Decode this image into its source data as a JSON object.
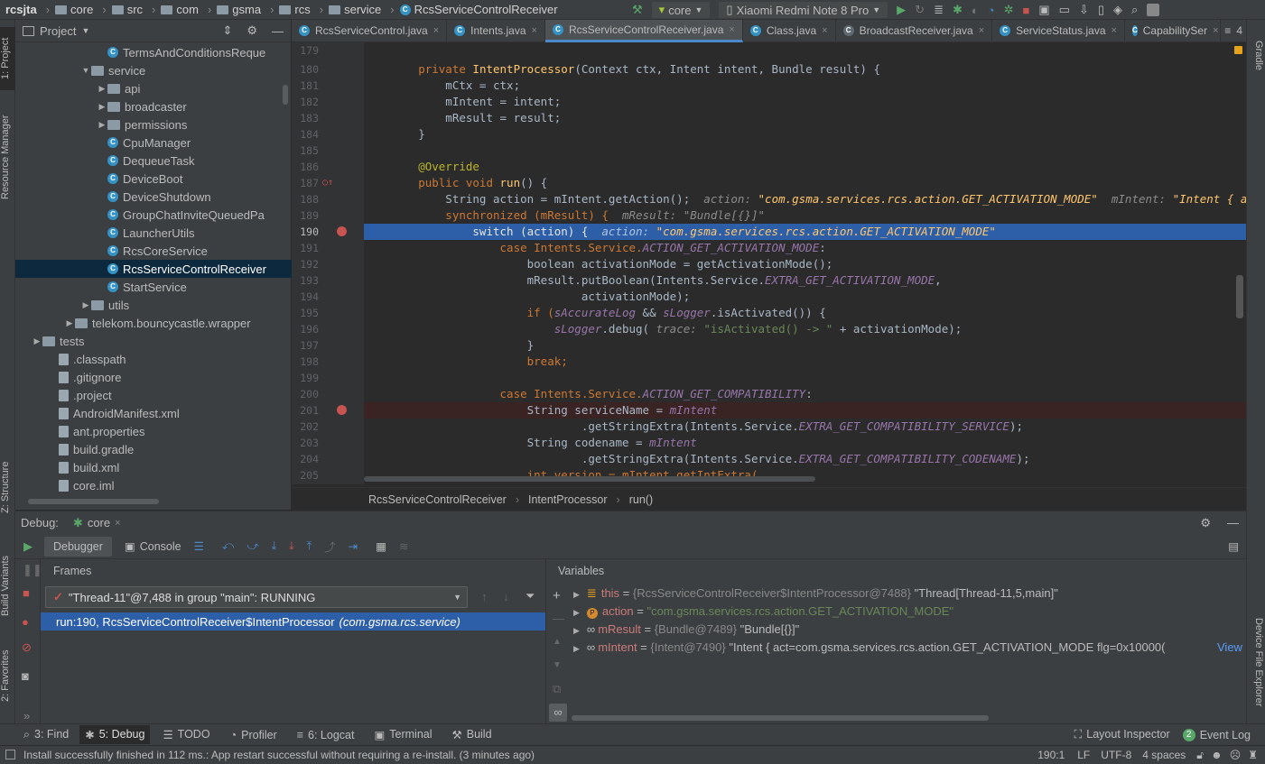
{
  "topbar": {
    "breadcrumbs": [
      "rcsjta",
      "core",
      "src",
      "com",
      "gsma",
      "rcs",
      "service",
      "RcsServiceControlReceiver"
    ],
    "run_config": "core",
    "device": "Xiaomi Redmi Note 8 Pro"
  },
  "project": {
    "title": "Project",
    "items": [
      {
        "label": "TermsAndConditionsReque",
        "type": "class"
      },
      {
        "label": "service",
        "type": "folder"
      },
      {
        "label": "api",
        "type": "folder"
      },
      {
        "label": "broadcaster",
        "type": "folder"
      },
      {
        "label": "permissions",
        "type": "folder"
      },
      {
        "label": "CpuManager",
        "type": "class"
      },
      {
        "label": "DequeueTask",
        "type": "class"
      },
      {
        "label": "DeviceBoot",
        "type": "class"
      },
      {
        "label": "DeviceShutdown",
        "type": "class"
      },
      {
        "label": "GroupChatInviteQueuedPa",
        "type": "class"
      },
      {
        "label": "LauncherUtils",
        "type": "class"
      },
      {
        "label": "RcsCoreService",
        "type": "class"
      },
      {
        "label": "RcsServiceControlReceiver",
        "type": "class"
      },
      {
        "label": "StartService",
        "type": "class"
      },
      {
        "label": "utils",
        "type": "folder"
      },
      {
        "label": "telekom.bouncycastle.wrapper",
        "type": "folder"
      },
      {
        "label": "tests",
        "type": "folder"
      },
      {
        "label": ".classpath",
        "type": "file"
      },
      {
        "label": ".gitignore",
        "type": "file"
      },
      {
        "label": ".project",
        "type": "file"
      },
      {
        "label": "AndroidManifest.xml",
        "type": "file"
      },
      {
        "label": "ant.properties",
        "type": "file"
      },
      {
        "label": "build.gradle",
        "type": "file"
      },
      {
        "label": "build.xml",
        "type": "file"
      },
      {
        "label": "core.iml",
        "type": "file"
      }
    ]
  },
  "tabs": [
    "RcsServiceControl.java",
    "Intents.java",
    "RcsServiceControlReceiver.java",
    "Class.java",
    "BroadcastReceiver.java",
    "ServiceStatus.java",
    "CapabilitySer"
  ],
  "tabs_overflow": "4",
  "editor": {
    "line_numbers": [
      "179",
      "180",
      "181",
      "182",
      "183",
      "184",
      "185",
      "186",
      "187",
      "188",
      "189",
      "190",
      "191",
      "192",
      "193",
      "194",
      "195",
      "196",
      "197",
      "198",
      "199",
      "200",
      "201",
      "202",
      "203",
      "204",
      "205"
    ],
    "lines": {
      "l180a": "        private ",
      "l180b": "IntentProcessor",
      "l180c": "(Context ctx, Intent intent, Bundle result) {",
      "l181": "            mCtx = ctx;",
      "l182": "            mIntent = intent;",
      "l183": "            mResult = result;",
      "l184": "        }",
      "l186": "        @Override",
      "l187a": "        public void ",
      "l187b": "run",
      "l187c": "() {",
      "l188a": "            String action = mIntent.getAction();  ",
      "l188b": "action: ",
      "l188c": "\"com.gsma.services.rcs.action.GET_ACTIVATION_MODE\"",
      "l188d": "  mIntent: ",
      "l188e": "\"Intent { act=com.gsm",
      "l189a": "            synchronized (mResult) {  ",
      "l189b": "mResult: \"Bundle[{}]\"",
      "l190a": "                switch (action) {  ",
      "l190b": "action: ",
      "l190c": "\"com.gsma.services.rcs.action.GET_ACTIVATION_MODE\"",
      "l191a": "                    case Intents.Service.",
      "l191b": "ACTION_GET_ACTIVATION_MODE",
      "l191c": ":",
      "l192": "                        boolean activationMode = getActivationMode();",
      "l193a": "                        mResult.putBoolean(Intents.Service.",
      "l193b": "EXTRA_GET_ACTIVATION_MODE",
      "l193c": ",",
      "l194": "                                activationMode);",
      "l195a": "                        if (",
      "l195b": "sAccurateLog",
      "l195c": " && ",
      "l195d": "sLogger",
      "l195e": ".isActivated()) {",
      "l196a": "                            ",
      "l196b": "sLogger",
      "l196c": ".debug( ",
      "l196d": "trace: ",
      "l196e": "\"isActivated() -> \"",
      "l196f": " + activationMode);",
      "l197": "                        }",
      "l198": "                        break;",
      "l200a": "                    case Intents.Service.",
      "l200b": "ACTION_GET_COMPATIBILITY",
      "l200c": ":",
      "l201a": "                        String serviceName = ",
      "l201b": "mIntent",
      "l202a": "                                .getStringExtra(Intents.Service.",
      "l202b": "EXTRA_GET_COMPATIBILITY_SERVICE",
      "l202c": ");",
      "l203a": "                        String codename = ",
      "l203b": "mIntent",
      "l204a": "                                .getStringExtra(Intents.Service.",
      "l204b": "EXTRA_GET_COMPATIBILITY_CODENAME",
      "l204c": ");",
      "l205": "                        int version = mIntent.getIntExtra("
    },
    "breadcrumb": [
      "RcsServiceControlReceiver",
      "IntentProcessor",
      "run()"
    ]
  },
  "debug": {
    "label": "Debug:",
    "session": "core",
    "tabs": {
      "debugger": "Debugger",
      "console": "Console"
    },
    "frames_title": "Frames",
    "variables_title": "Variables",
    "thread": "\"Thread-11\"@7,488 in group \"main\": RUNNING",
    "frame": {
      "loc": "run:190, RcsServiceControlReceiver$IntentProcessor",
      "pkg": "(com.gsma.rcs.service)"
    },
    "variables": [
      {
        "name": "this",
        "ref": "{RcsServiceControlReceiver$IntentProcessor@7488}",
        "value": "\"Thread[Thread-11,5,main]\""
      },
      {
        "name": "action",
        "ref": "",
        "value": "\"com.gsma.services.rcs.action.GET_ACTIVATION_MODE\""
      },
      {
        "name": "mResult",
        "ref": "{Bundle@7489}",
        "value": "\"Bundle[{}]\""
      },
      {
        "name": "mIntent",
        "ref": "{Intent@7490}",
        "value": "\"Intent { act=com.gsma.services.rcs.action.GET_ACTIVATION_MODE flg=0x10000(",
        "link": "View"
      }
    ]
  },
  "toolwindows": {
    "find": "3: Find",
    "debug": "5: Debug",
    "todo": "TODO",
    "profiler": "Profiler",
    "logcat": "6: Logcat",
    "terminal": "Terminal",
    "build": "Build",
    "layout_inspector": "Layout Inspector",
    "event_log": "Event Log",
    "event_count": "2"
  },
  "left_tools": {
    "project": "1: Project",
    "resource_manager": "Resource Manager",
    "structure": "Z: Structure",
    "build_variants": "Build Variants",
    "favorites": "2: Favorites"
  },
  "right_tools": {
    "gradle": "Gradle",
    "device_file_explorer": "Device File Explorer"
  },
  "status": {
    "message": "Install successfully finished in 112 ms.: App restart successful without requiring a re-install. (3 minutes ago)",
    "position": "190:1",
    "line_sep": "LF",
    "encoding": "UTF-8",
    "indent": "4 spaces"
  },
  "colors": {
    "accent": "#2d5fa8",
    "breakpoint": "#c75450",
    "selection": "#0d293e"
  }
}
